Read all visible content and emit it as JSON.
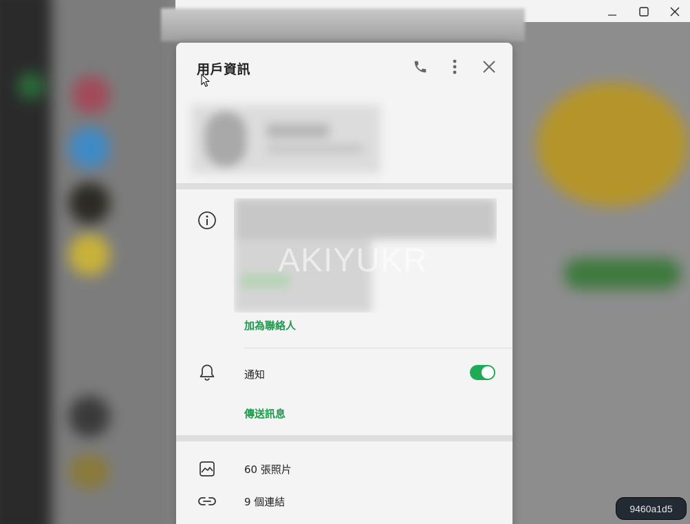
{
  "window": {
    "controls": [
      "minimize",
      "maximize",
      "close"
    ]
  },
  "dialog": {
    "title": "用戶資訊",
    "header_icons": [
      "phone-icon",
      "more-vertical-icon",
      "close-icon"
    ]
  },
  "bio": {
    "watermark": "AKIYUKR",
    "add_contact_label": "加為聯絡人"
  },
  "notifications": {
    "label": "通知",
    "enabled": true,
    "send_message_label": "傳送訊息"
  },
  "media": {
    "photos_label": "60 張照片",
    "links_label": "9 個連結"
  },
  "overlay_badge": {
    "text": "9460a1d5"
  },
  "colors": {
    "accent_green": "#1a9b4b",
    "toggle_on": "#1fab55",
    "dialog_bg": "#f4f4f4"
  }
}
